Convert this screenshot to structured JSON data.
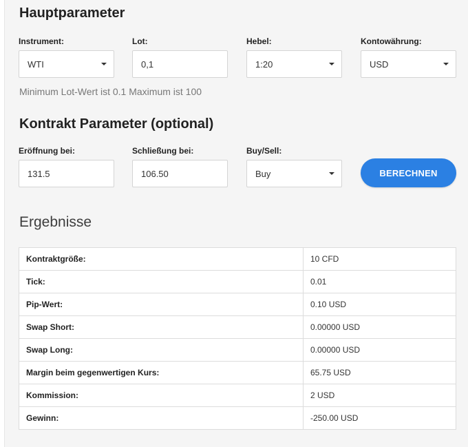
{
  "main": {
    "title": "Hauptparameter",
    "instrument": {
      "label": "Instrument:",
      "value": "WTI"
    },
    "lot": {
      "label": "Lot:",
      "value": "0,1"
    },
    "leverage": {
      "label": "Hebel:",
      "value": "1:20"
    },
    "currency": {
      "label": "Kontowährung:",
      "value": "USD"
    },
    "hint": "Minimum Lot-Wert ist 0.1 Maximum ist 100"
  },
  "contract": {
    "title": "Kontrakt Parameter (optional)",
    "open": {
      "label": "Eröffnung bei:",
      "value": "131.5"
    },
    "close": {
      "label": "Schließung bei:",
      "value": "106.50"
    },
    "side": {
      "label": "Buy/Sell:",
      "value": "Buy"
    },
    "calculate_label": "BERECHNEN"
  },
  "results": {
    "title": "Ergebnisse",
    "rows": [
      {
        "label": "Kontraktgröße:",
        "value": "10 CFD"
      },
      {
        "label": "Tick:",
        "value": "0.01"
      },
      {
        "label": "Pip-Wert:",
        "value": "0.10 USD"
      },
      {
        "label": "Swap Short:",
        "value": "0.00000 USD"
      },
      {
        "label": "Swap Long:",
        "value": "0.00000 USD"
      },
      {
        "label": "Margin beim gegenwertigen Kurs:",
        "value": "65.75 USD"
      },
      {
        "label": "Kommission:",
        "value": "2 USD"
      },
      {
        "label": "Gewinn:",
        "value": "-250.00 USD"
      }
    ]
  },
  "colors": {
    "accent": "#2b80e3",
    "panel_bg": "#f5f5f5"
  },
  "icons": {
    "dropdown": "caret-down-icon"
  }
}
